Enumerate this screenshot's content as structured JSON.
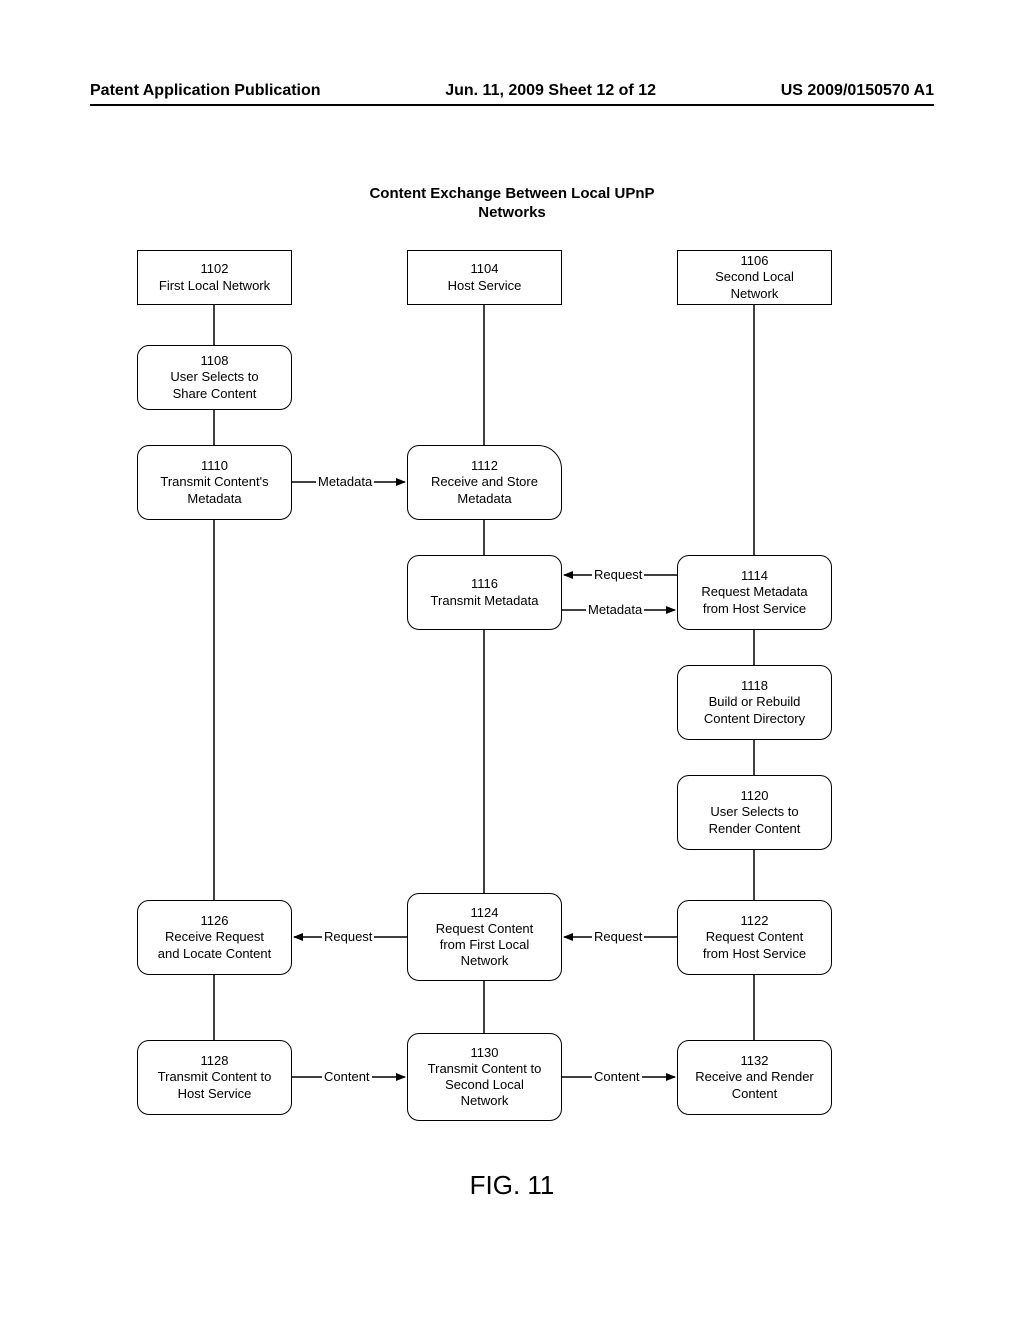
{
  "header": {
    "left": "Patent Application Publication",
    "center": "Jun. 11, 2009  Sheet 12 of 12",
    "right": "US 2009/0150570 A1"
  },
  "title_line1": "Content Exchange Between Local UPnP",
  "title_line2": "Networks",
  "figcap": "FIG. 11",
  "lanes": {
    "first": {
      "id": "1102",
      "label": "First Local Network"
    },
    "host": {
      "id": "1104",
      "label": "Host Service"
    },
    "second": {
      "id": "1106",
      "label1": "Second Local",
      "label2": "Network"
    }
  },
  "b1108": {
    "id": "1108",
    "l1": "User Selects to",
    "l2": "Share Content"
  },
  "b1110": {
    "id": "1110",
    "l1": "Transmit Content's",
    "l2": "Metadata"
  },
  "b1112": {
    "id": "1112",
    "l1": "Receive and Store",
    "l2": "Metadata"
  },
  "b1114": {
    "id": "1114",
    "l1": "Request Metadata",
    "l2": "from Host Service"
  },
  "b1116": {
    "id": "1116",
    "l1": "Transmit Metadata"
  },
  "b1118": {
    "id": "1118",
    "l1": "Build or Rebuild",
    "l2": "Content Directory"
  },
  "b1120": {
    "id": "1120",
    "l1": "User Selects to",
    "l2": "Render Content"
  },
  "b1122": {
    "id": "1122",
    "l1": "Request Content",
    "l2": "from Host Service"
  },
  "b1124": {
    "id": "1124",
    "l1": "Request Content",
    "l2": "from First Local",
    "l3": "Network"
  },
  "b1126": {
    "id": "1126",
    "l1": "Receive Request",
    "l2": "and Locate Content"
  },
  "b1128": {
    "id": "1128",
    "l1": "Transmit Content to",
    "l2": "Host Service"
  },
  "b1130": {
    "id": "1130",
    "l1": "Transmit Content to",
    "l2": "Second Local",
    "l3": "Network"
  },
  "b1132": {
    "id": "1132",
    "l1": "Receive and Render",
    "l2": "Content"
  },
  "arrows": {
    "metadata": "Metadata",
    "request": "Request",
    "content": "Content"
  }
}
